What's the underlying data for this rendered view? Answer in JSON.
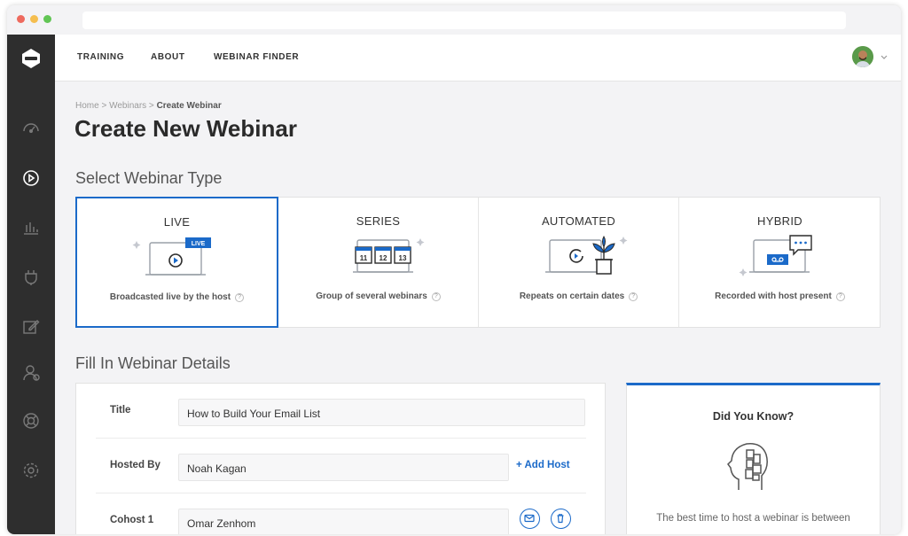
{
  "nav": {
    "items": [
      "TRAINING",
      "ABOUT",
      "WEBINAR FINDER"
    ]
  },
  "breadcrumb": {
    "home": "Home",
    "sep1": " > ",
    "webinars": "Webinars",
    "sep2": " > ",
    "current": "Create Webinar"
  },
  "page_title": "Create New Webinar",
  "select_type": {
    "heading": "Select Webinar Type",
    "types": [
      {
        "name": "LIVE",
        "desc": "Broadcasted live by the host",
        "badge": "LIVE"
      },
      {
        "name": "SERIES",
        "desc": "Group of several webinars",
        "dates": [
          "11",
          "12",
          "13"
        ]
      },
      {
        "name": "AUTOMATED",
        "desc": "Repeats on certain dates"
      },
      {
        "name": "HYBRID",
        "desc": "Recorded with host present",
        "bubble": "..."
      }
    ],
    "help": "?"
  },
  "details": {
    "heading": "Fill In Webinar Details",
    "title_label": "Title",
    "title_value": "How to Build Your Email List",
    "hosted_label": "Hosted By",
    "hosted_value": "Noah Kagan",
    "add_host": "+ Add Host",
    "cohost_label": "Cohost 1",
    "cohost_value": "Omar Zenhom"
  },
  "tip": {
    "title": "Did You Know?",
    "text": "The best time to host a webinar is between"
  },
  "colors": {
    "accent": "#1b6ac9",
    "sidebar": "#2e2e2e"
  },
  "icons": [
    "logo-icon",
    "dashboard-icon",
    "play-icon",
    "analytics-icon",
    "plugin-icon",
    "edit-icon",
    "users-icon",
    "support-icon",
    "settings-icon"
  ]
}
